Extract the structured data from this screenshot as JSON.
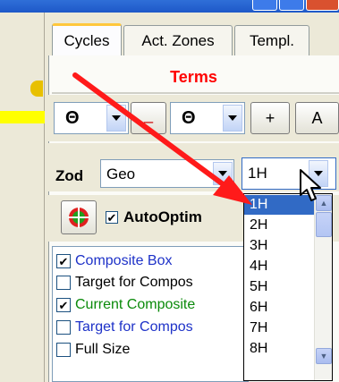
{
  "tabs": [
    {
      "label": "Cycles",
      "active": true
    },
    {
      "label": "Act. Zones",
      "active": false
    },
    {
      "label": "Templ.",
      "active": false
    }
  ],
  "panel": {
    "title": "Terms",
    "title_color": "#ff0000"
  },
  "toolbar": {
    "planet_left": {
      "glyph": "Θ"
    },
    "minus_label": "_",
    "planet_right": {
      "glyph": "Θ"
    },
    "plus_label": "+",
    "a_label": "A"
  },
  "zod": {
    "label": "Zod",
    "value": "Geo",
    "house_value": "1H"
  },
  "auto_optimize": {
    "label": "AutoOptim",
    "checked": true
  },
  "layers": [
    {
      "label": "Composite Box",
      "checked": true,
      "color": "#1e32c8"
    },
    {
      "label": "Target for Compos",
      "checked": false,
      "color": "#000000"
    },
    {
      "label": "Current Composite",
      "checked": true,
      "color": "#0a8a0a"
    },
    {
      "label": "Target for Compos",
      "checked": false,
      "color": "#1e32c8"
    },
    {
      "label": "Full Size",
      "checked": false,
      "color": "#000000"
    }
  ],
  "house_dropdown": {
    "options": [
      "1H",
      "2H",
      "3H",
      "4H",
      "5H",
      "6H",
      "7H",
      "8H"
    ],
    "selected": "1H"
  },
  "colors": {
    "accent": "#316ac5",
    "annotation_arrow": "#ff1a1a"
  }
}
